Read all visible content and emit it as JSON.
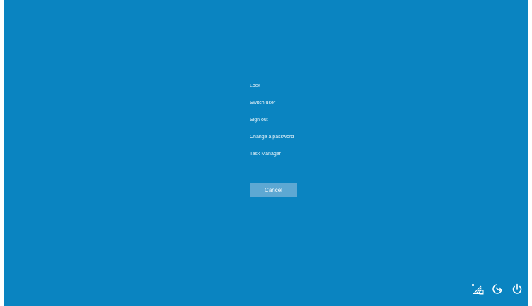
{
  "menu": {
    "items": [
      {
        "label": "Lock"
      },
      {
        "label": "Switch user"
      },
      {
        "label": "Sign out"
      },
      {
        "label": "Change a password"
      },
      {
        "label": "Task Manager"
      }
    ]
  },
  "cancel_label": "Cancel",
  "tray": {
    "icons": [
      "network-icon",
      "ease-of-access-icon",
      "power-icon"
    ]
  },
  "colors": {
    "background": "#0a84c1",
    "button": "#5da8d3",
    "text": "#ffffff"
  }
}
